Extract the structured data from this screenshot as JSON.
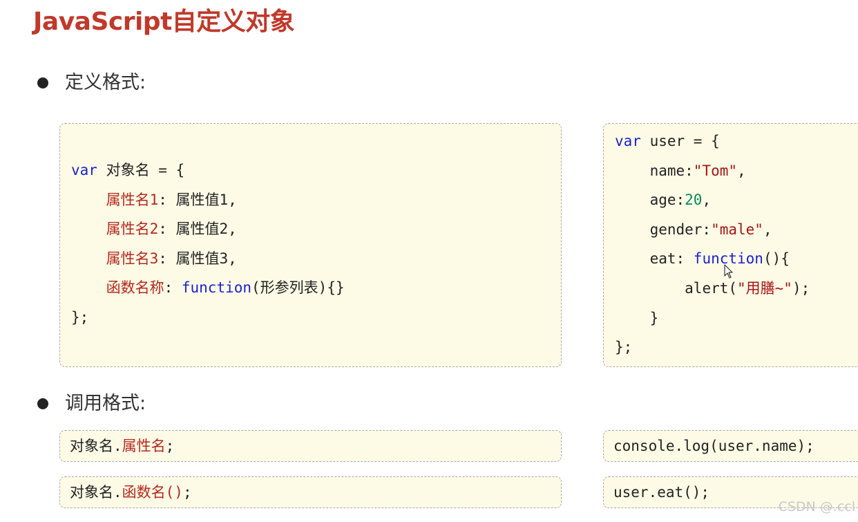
{
  "slide": {
    "title": "JavaScript自定义对象"
  },
  "definition": {
    "heading": "定义格式:",
    "template": {
      "var_kw": "var",
      "object_name": " 对象名 = {",
      "props": [
        {
          "name": "属性名1",
          "sep": ": ",
          "value": "属性值1,"
        },
        {
          "name": "属性名2",
          "sep": ": ",
          "value": "属性值2,"
        },
        {
          "name": "属性名3",
          "sep": ": ",
          "value": "属性值3,"
        }
      ],
      "func_name": "函数名称",
      "func_sep": ": ",
      "func_kw": "function",
      "func_params": "(形参列表){}",
      "close": "};"
    },
    "example": {
      "var_kw": "var",
      "decl": " user = {",
      "name_key": "name:",
      "name_value": "\"Tom\"",
      "name_comma": ",",
      "age_key": "age:",
      "age_value": "20",
      "age_comma": ",",
      "gender_key": "gender:",
      "gender_value": "\"male\"",
      "gender_comma": ",",
      "eat_key": "eat: ",
      "eat_kw": "function",
      "eat_rest": "(){",
      "alert_open": "alert(",
      "alert_value": "\"用膳~\"",
      "alert_close": ");",
      "inner_close": "}",
      "close": "};"
    }
  },
  "invocation": {
    "heading": "调用格式:",
    "template_property": {
      "object": "对象名.",
      "member": "属性名",
      "end": ";"
    },
    "template_method": {
      "object": "对象名.",
      "member": "函数名()",
      "end": ";"
    },
    "example_property": "console.log(user.name);",
    "example_method": "user.eat();"
  },
  "watermark": "CSDN @.ccl",
  "colors": {
    "title": "#c0392b",
    "keyword": "#1a1fd1",
    "property": "#b3281e",
    "string": "#a31515",
    "number": "#098658",
    "code_background": "#fdfbe6"
  },
  "icons": {
    "bullet": "filled-circle",
    "cursor": "mouse-pointer"
  }
}
